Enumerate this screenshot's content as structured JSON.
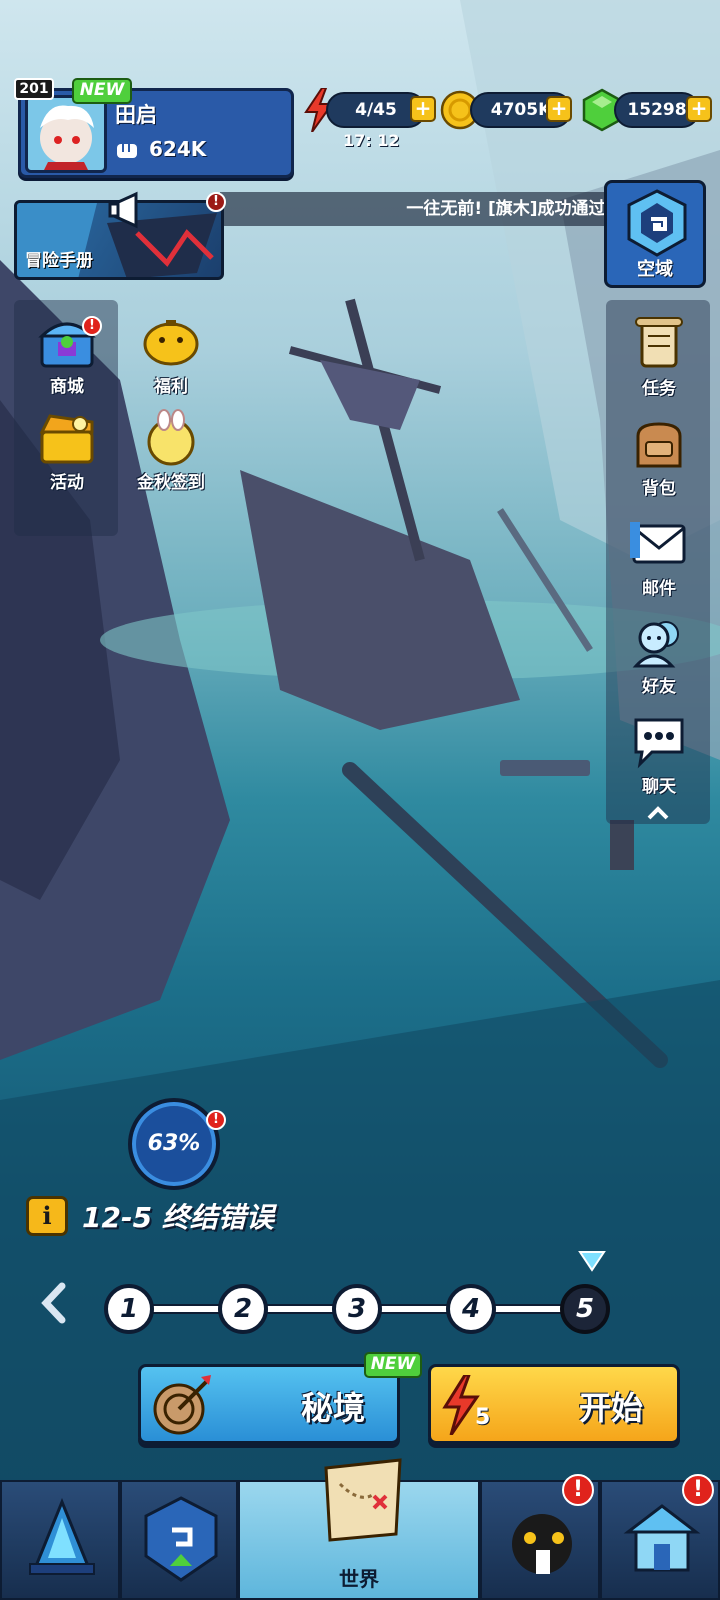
{
  "player": {
    "level": "201",
    "new_tag": "NEW",
    "name": "田启",
    "power": "624K"
  },
  "resources": {
    "energy": "4/45",
    "energy_timer": "17: 12",
    "gold": "4705K",
    "gems": "15298"
  },
  "banner": {
    "handbook_label": "冒险手册",
    "marquee_text": "一往无前! [旗木]成功通过.",
    "airspace_label": "空域"
  },
  "left_menu": [
    {
      "label": "商城",
      "icon": "treasure-chest-icon",
      "badge": "!"
    },
    {
      "label": "福利",
      "icon": "welfare-pig-icon"
    },
    {
      "label": "活动",
      "icon": "event-chest-icon"
    },
    {
      "label": "金秋签到",
      "icon": "autumn-checkin-icon"
    }
  ],
  "right_menu": [
    {
      "label": "任务",
      "icon": "scroll-icon"
    },
    {
      "label": "背包",
      "icon": "bag-icon"
    },
    {
      "label": "邮件",
      "icon": "mail-icon"
    },
    {
      "label": "好友",
      "icon": "friends-icon"
    },
    {
      "label": "聊天",
      "icon": "chat-icon"
    }
  ],
  "progress": {
    "percent": "63%",
    "badge": "!"
  },
  "stage": {
    "info_icon": "i",
    "title": "12-5 终结错误"
  },
  "chapter_nodes": [
    "1",
    "2",
    "3",
    "4",
    "5"
  ],
  "current_node": "5",
  "actions": {
    "secret_label": "秘境",
    "secret_new": "NEW",
    "start_label": "开始",
    "start_cost": "5"
  },
  "bottom_nav": [
    {
      "icon": "crystal-tower-icon",
      "label": ""
    },
    {
      "icon": "upgrade-shield-icon",
      "label": ""
    },
    {
      "icon": "treasure-map-icon",
      "label": "世界"
    },
    {
      "icon": "hero-character-icon",
      "label": "",
      "badge": "!"
    },
    {
      "icon": "guild-house-icon",
      "label": "",
      "badge": "!"
    }
  ],
  "colors": {
    "accent_yellow": "#f6c21a",
    "accent_blue": "#2a5aa8",
    "new_green": "#4fcf3c",
    "alert_red": "#e0231c"
  }
}
